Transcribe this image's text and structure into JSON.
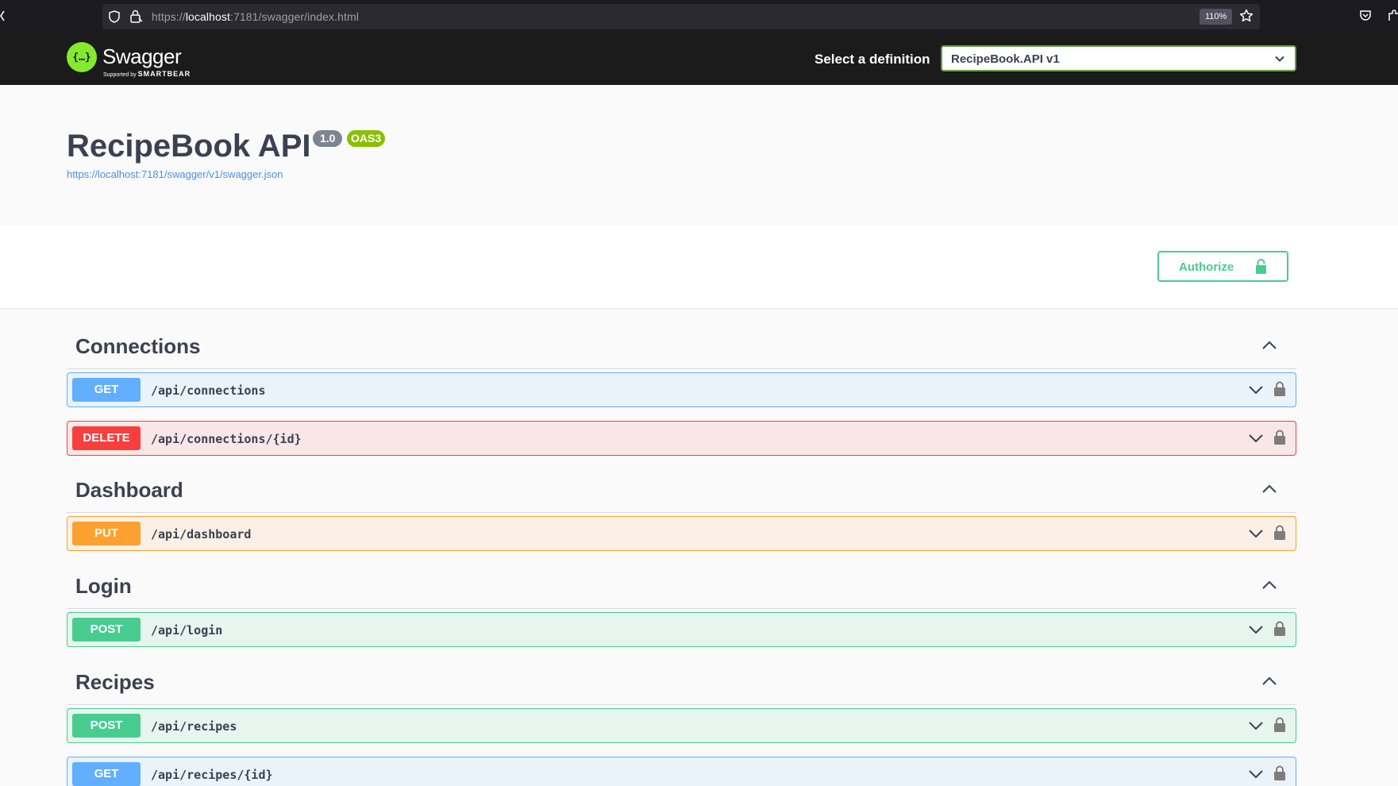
{
  "browser": {
    "url_prefix": "https://",
    "url_host": "localhost",
    "url_rest": ":7181/swagger/index.html",
    "zoom": "110%"
  },
  "topbar": {
    "logo_name": "Swagger",
    "logo_sub_small": "Supported by",
    "logo_sub_brand": "SMARTBEAR",
    "logo_glyph": "{…}",
    "definition_label": "Select a definition",
    "definition_value": "RecipeBook.API v1"
  },
  "info": {
    "title": "RecipeBook API",
    "version": "1.0",
    "oas": "OAS3",
    "spec_url": "https://localhost:7181/swagger/v1/swagger.json"
  },
  "scheme": {
    "authorize_label": "Authorize"
  },
  "tags": [
    {
      "name": "Connections",
      "operations": [
        {
          "method": "GET",
          "path": "/api/connections"
        },
        {
          "method": "DELETE",
          "path": "/api/connections/{id}"
        }
      ]
    },
    {
      "name": "Dashboard",
      "operations": [
        {
          "method": "PUT",
          "path": "/api/dashboard"
        }
      ]
    },
    {
      "name": "Login",
      "operations": [
        {
          "method": "POST",
          "path": "/api/login"
        }
      ]
    },
    {
      "name": "Recipes",
      "operations": [
        {
          "method": "POST",
          "path": "/api/recipes"
        },
        {
          "method": "GET",
          "path": "/api/recipes/{id}"
        }
      ]
    }
  ],
  "colors": {
    "get": "#61affe",
    "delete": "#f93e3e",
    "put": "#fca130",
    "post": "#49cc90",
    "swagger_green": "#85ea2d",
    "oas_badge": "#89bf04"
  }
}
